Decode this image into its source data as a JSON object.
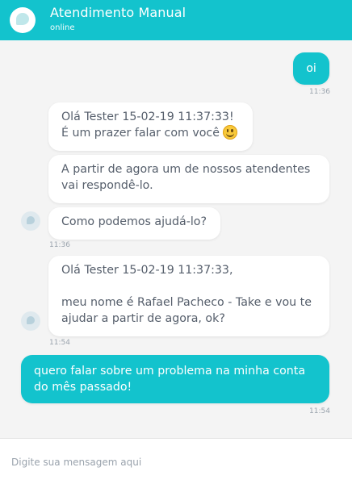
{
  "header": {
    "title": "Atendimento Manual",
    "status": "online"
  },
  "messages": {
    "m1": {
      "text": "oi",
      "time": "11:36"
    },
    "m2": {
      "line1": "Olá Tester 15-02-19 11:37:33!",
      "line2": "É um prazer falar com você"
    },
    "m3": {
      "line1": "A partir de agora um de nossos atendentes",
      "line2": "vai respondê-lo."
    },
    "m4": {
      "text": "Como podemos ajudá-lo?",
      "time": "11:36"
    },
    "m5": {
      "line1": "Olá Tester 15-02-19 11:37:33,",
      "line2": "meu nome é Rafael Pacheco - Take e vou te",
      "line3": "ajudar a partir de agora, ok?",
      "time": "11:54"
    },
    "m6": {
      "line1": "quero falar sobre um problema na minha conta",
      "line2": "do mês passado!",
      "time": "11:54"
    }
  },
  "composer": {
    "placeholder": "Digite sua mensagem aqui"
  }
}
